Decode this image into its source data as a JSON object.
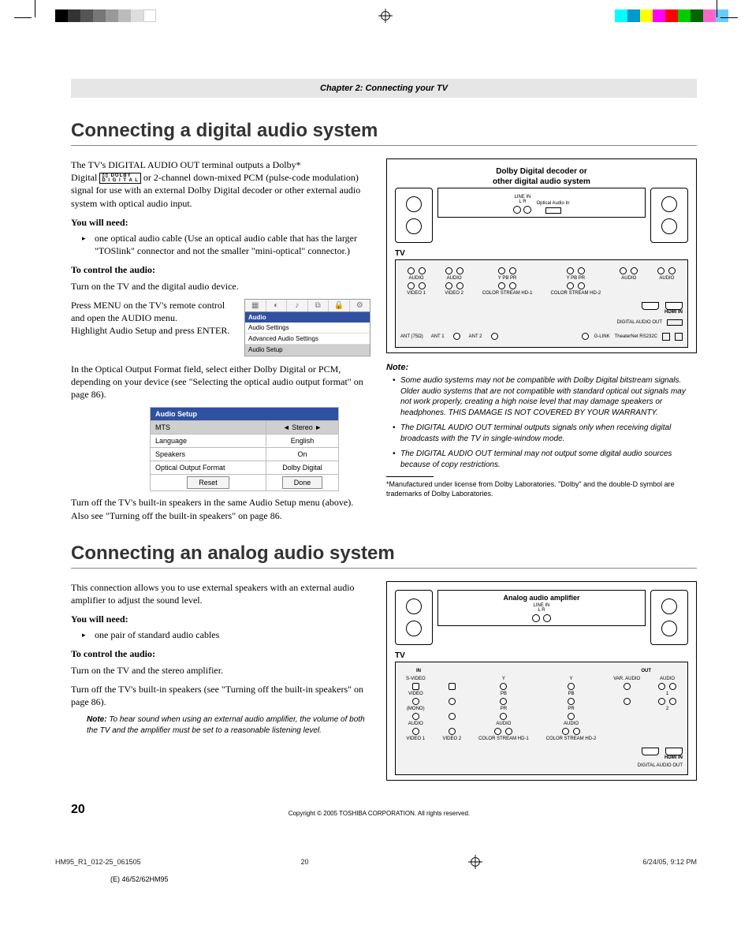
{
  "chapterBand": "Chapter 2: Connecting your TV",
  "section1": {
    "title": "Connecting a digital audio system",
    "para1a": "The TV's DIGITAL AUDIO OUT terminal outputs a Dolby*",
    "para1b": "Digital ",
    "para1c": " or 2-channel down-mixed PCM (pulse-code modulation) signal for use with an external Dolby Digital decoder or other external audio system with optical audio input.",
    "needH": "You will need:",
    "needItem": "one optical audio cable (Use an optical audio cable that has the larger \"TOSlink\" connector and not the smaller \"mini-optical\" connector.)",
    "ctrlH": "To control the audio:",
    "ctrlP1": "Turn on the TV and the digital audio device.",
    "menuP1": "Press MENU on the TV's remote control and open the AUDIO menu.",
    "menuP2": "Highlight Audio Setup and press ENTER.",
    "menu": {
      "header": "Audio",
      "items": [
        "Audio Settings",
        "Advanced Audio Settings",
        "Audio Setup"
      ]
    },
    "afterMenu": "In the Optical Output Format field, select either Dolby Digital or PCM, depending on your device (see \"Selecting the optical audio output format\" on page 86).",
    "osd": {
      "header": "Audio Setup",
      "rows": [
        {
          "label": "MTS",
          "value": "◄       Stereo       ►"
        },
        {
          "label": "Language",
          "value": "English"
        },
        {
          "label": "Speakers",
          "value": "On"
        },
        {
          "label": "Optical Output Format",
          "value": "Dolby Digital"
        }
      ],
      "btnReset": "Reset",
      "btnDone": "Done"
    },
    "afterOsd": "Turn off the TV's built-in speakers in the same Audio Setup menu (above). Also see \"Turning off the built-in speakers\" on page 86.",
    "diag": {
      "title1": "Dolby Digital decoder or",
      "title2": "other digital audio system",
      "lineinL": "LINE IN",
      "lr": "L     R",
      "opt": "Optical Audio In",
      "tv": "TV",
      "hdmi": "HDMI IN",
      "dao": "DIGITAL AUDIO OUT",
      "ant": "ANT (75Ω)",
      "ant1": "ANT 1",
      "ant2": "ANT 2",
      "glink": "G-LINK",
      "theater": "TheaterNet RS232C",
      "video1": "VIDEO 1",
      "video2": "VIDEO 2",
      "cs1": "COLOR STREAM HD-1",
      "cs2": "COLOR STREAM HD-2"
    },
    "noteH": "Note:",
    "notes": [
      "Some audio systems may not be compatible with Dolby Digital bitstream signals. Older audio systems that are not compatible with standard optical out signals may not work properly, creating a high noise level that may damage speakers or headphones. THIS DAMAGE IS NOT COVERED BY YOUR WARRANTY.",
      "The DIGITAL AUDIO OUT terminal outputs signals only when receiving digital broadcasts with the TV in single-window mode.",
      "The DIGITAL AUDIO OUT terminal may not output some digital audio sources because of copy restrictions."
    ],
    "footnote": "*Manufactured under license from Dolby Laboratories. \"Dolby\" and the double-D symbol are trademarks of Dolby Laboratories."
  },
  "section2": {
    "title": "Connecting an analog audio system",
    "para1": "This connection allows you to use external speakers with an external audio amplifier to adjust the sound level.",
    "needH": "You will need:",
    "needItem": "one pair of standard audio cables",
    "ctrlH": "To control the audio:",
    "ctrlP1": "Turn on the TV and the stereo amplifier.",
    "ctrlP2": "Turn off the TV's built-in speakers (see \"Turning off the built-in speakers\" on page 86).",
    "noteInline": "To hear sound when using an external audio amplifier, the volume of both the TV and the amplifier must be set to a reasonable listening level.",
    "noteLabel": "Note: ",
    "diag": {
      "title": "Analog audio amplifier",
      "lineinL": "LINE IN",
      "lr": "L     R",
      "tv": "TV",
      "in": "IN",
      "out": "OUT",
      "svideo": "S-VIDEO",
      "video": "VIDEO",
      "mono": "(MONO)",
      "audio": "AUDIO",
      "var": "VAR. AUDIO",
      "video1": "VIDEO 1",
      "video2": "VIDEO 2",
      "cs1": "COLOR STREAM HD-1",
      "cs2": "COLOR STREAM HD-2",
      "hdmi": "HDMI IN",
      "dao": "DIGITAL AUDIO OUT"
    }
  },
  "pageNum": "20",
  "copyright": "Copyright © 2005 TOSHIBA CORPORATION. All rights reserved.",
  "printFoot": {
    "file": "HM95_R1_012-25_061505",
    "pg": "20",
    "date": "6/24/05, 9:12 PM"
  },
  "tail": "(E) 46/52/62HM95"
}
